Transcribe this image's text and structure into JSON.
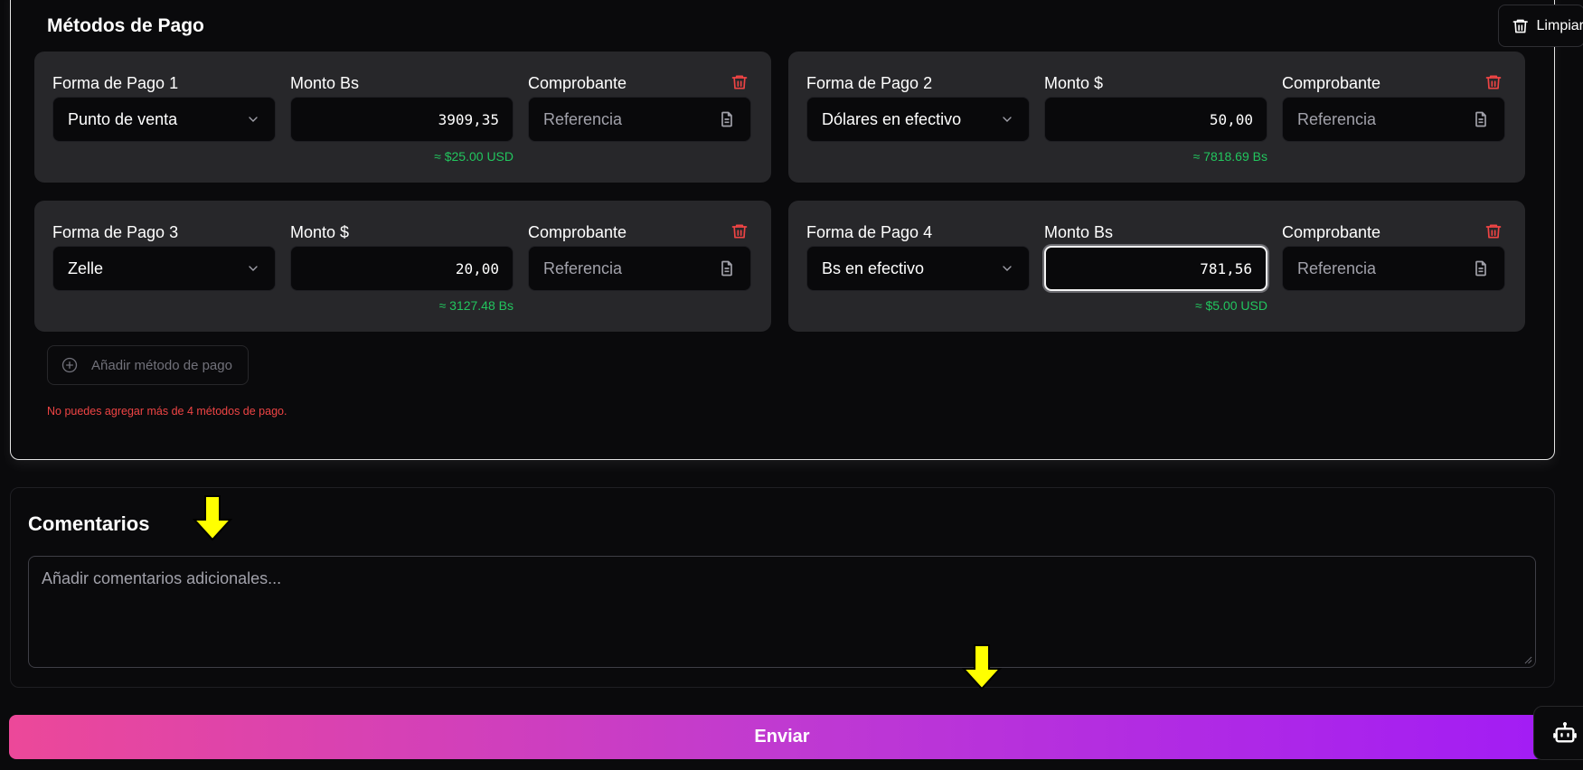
{
  "payment_section": {
    "title": "Métodos de Pago",
    "clear_label": "Limpiar",
    "methods": [
      {
        "label": "Forma de Pago 1",
        "method": "Punto de venta",
        "amount_label": "Monto Bs",
        "amount": "3909,35",
        "conversion": "≈ $25.00 USD",
        "receipt_label": "Comprobante",
        "receipt_placeholder": "Referencia"
      },
      {
        "label": "Forma de Pago 2",
        "method": "Dólares en efectivo",
        "amount_label": "Monto $",
        "amount": "50,00",
        "conversion": "≈ 7818.69 Bs",
        "receipt_label": "Comprobante",
        "receipt_placeholder": "Referencia"
      },
      {
        "label": "Forma de Pago 3",
        "method": "Zelle",
        "amount_label": "Monto $",
        "amount": "20,00",
        "conversion": "≈ 3127.48 Bs",
        "receipt_label": "Comprobante",
        "receipt_placeholder": "Referencia"
      },
      {
        "label": "Forma de Pago 4",
        "method": "Bs en efectivo",
        "amount_label": "Monto Bs",
        "amount": "781,56",
        "conversion": "≈ $5.00 USD",
        "receipt_label": "Comprobante",
        "receipt_placeholder": "Referencia",
        "focused": true
      }
    ],
    "add_label": "Añadir método de pago",
    "limit_message": "No puedes agregar más de 4 métodos de pago."
  },
  "comments": {
    "title": "Comentarios",
    "placeholder": "Añadir comentarios adicionales..."
  },
  "submit_label": "Enviar",
  "colors": {
    "accent_green": "#22c55e",
    "danger_red": "#ef4444",
    "gradient_start": "#ec4899",
    "gradient_end": "#a21cf5",
    "annotation_arrow": "#ffff00"
  },
  "icons": [
    "trash-icon",
    "chevron-down-icon",
    "document-icon",
    "plus-circle-icon",
    "bot-icon",
    "arrow-down-icon"
  ]
}
